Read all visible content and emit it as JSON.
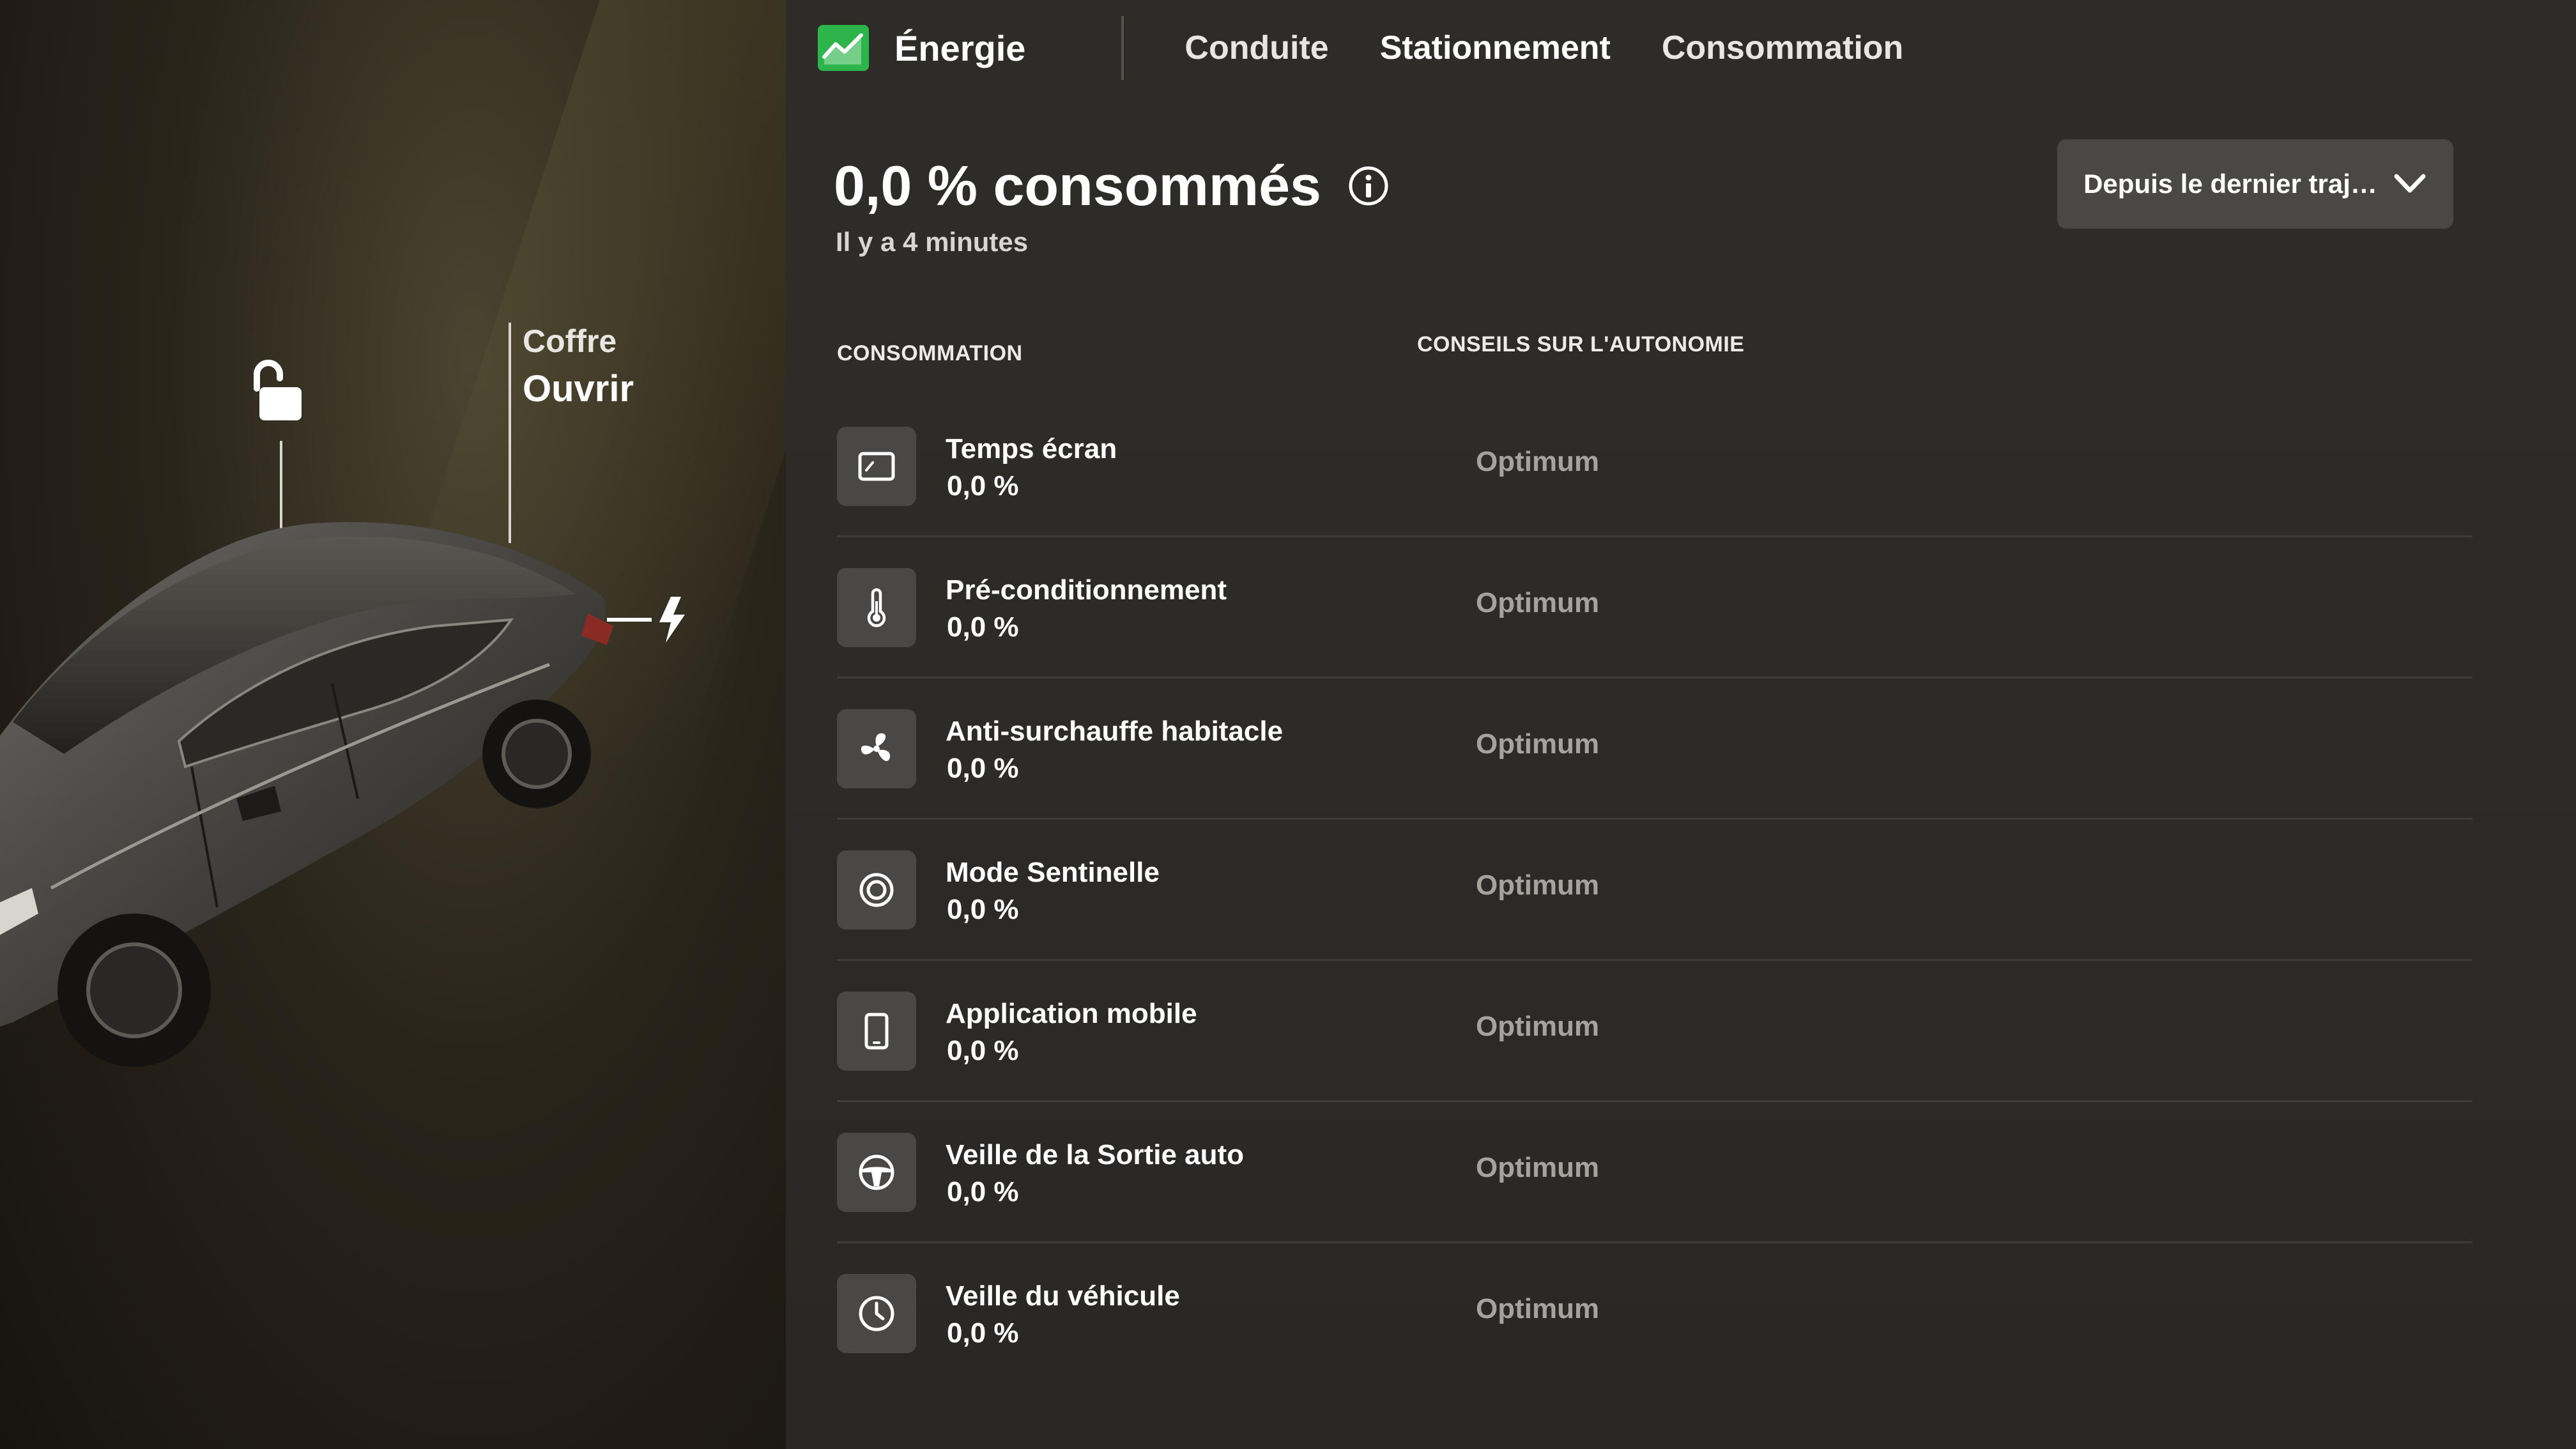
{
  "nav": {
    "title": "Énergie",
    "tabs": [
      {
        "label": "Conduite"
      },
      {
        "label": "Stationnement"
      },
      {
        "label": "Consommation"
      }
    ],
    "accent_color": "#2db54b"
  },
  "vehicle": {
    "trunk_label": "Coffre",
    "trunk_action": "Ouvrir",
    "lock_state_icon": "unlocked-padlock-icon",
    "charge_port_icon": "lightning-bolt-icon"
  },
  "summary": {
    "headline": "0,0 % consommés",
    "info_icon": "info-circle-icon",
    "subtitle": "Il y a 4 minutes"
  },
  "period_dropdown": {
    "selected": "Depuis le dernier traj…",
    "icon": "chevron-down-icon"
  },
  "table": {
    "col_consumption": "CONSOMMATION",
    "col_advice": "CONSEILS SUR L'AUTONOMIE",
    "rows": [
      {
        "name": "Temps écran",
        "value": "0,0 %",
        "advice": "Optimum",
        "icon": "screen-icon"
      },
      {
        "name": "Pré-conditionnement",
        "value": "0,0 %",
        "advice": "Optimum",
        "icon": "thermometer-icon"
      },
      {
        "name": "Anti-surchauffe habitacle",
        "value": "0,0 %",
        "advice": "Optimum",
        "icon": "fan-icon"
      },
      {
        "name": "Mode Sentinelle",
        "value": "0,0 %",
        "advice": "Optimum",
        "icon": "sentry-eye-icon"
      },
      {
        "name": "Application mobile",
        "value": "0,0 %",
        "advice": "Optimum",
        "icon": "phone-icon"
      },
      {
        "name": "Veille de la Sortie auto",
        "value": "0,0 %",
        "advice": "Optimum",
        "icon": "steering-wheel-icon"
      },
      {
        "name": "Veille du véhicule",
        "value": "0,0 %",
        "advice": "Optimum",
        "icon": "clock-icon"
      }
    ]
  }
}
